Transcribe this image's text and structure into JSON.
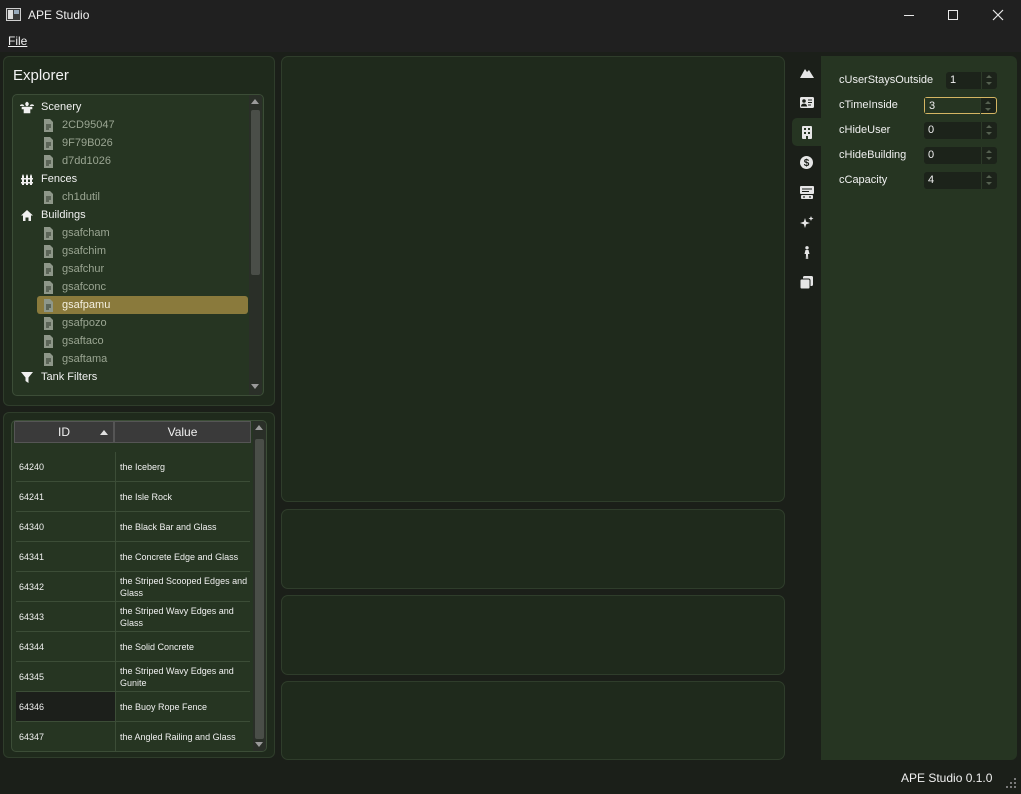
{
  "window": {
    "title": "APE Studio",
    "menu": {
      "file": "File"
    }
  },
  "explorer": {
    "title": "Explorer",
    "tree": [
      {
        "type": "category",
        "label": "Scenery",
        "icon": "fountain-icon"
      },
      {
        "type": "item",
        "label": "2CD95047"
      },
      {
        "type": "item",
        "label": "9F79B026"
      },
      {
        "type": "item",
        "label": "d7dd1026"
      },
      {
        "type": "category",
        "label": "Fences",
        "icon": "fence-icon"
      },
      {
        "type": "item",
        "label": "ch1dutil"
      },
      {
        "type": "category",
        "label": "Buildings",
        "icon": "home-icon"
      },
      {
        "type": "item",
        "label": "gsafcham"
      },
      {
        "type": "item",
        "label": "gsafchim"
      },
      {
        "type": "item",
        "label": "gsafchur"
      },
      {
        "type": "item",
        "label": "gsafconc"
      },
      {
        "type": "item",
        "label": "gsafpamu",
        "selected": true
      },
      {
        "type": "item",
        "label": "gsafpozo"
      },
      {
        "type": "item",
        "label": "gsaftaco"
      },
      {
        "type": "item",
        "label": "gsaftama"
      },
      {
        "type": "category",
        "label": "Tank Filters",
        "icon": "filter-icon"
      }
    ]
  },
  "table": {
    "columns": [
      "ID",
      "Value"
    ],
    "sort_column": "ID",
    "rows": [
      {
        "id": "64240",
        "value": "the Iceberg"
      },
      {
        "id": "64241",
        "value": "the Isle Rock"
      },
      {
        "id": "64340",
        "value": "the Black Bar and Glass"
      },
      {
        "id": "64341",
        "value": "the Concrete Edge and Glass"
      },
      {
        "id": "64342",
        "value": "the Striped Scooped Edges and Glass"
      },
      {
        "id": "64343",
        "value": "the Striped Wavy Edges and Glass"
      },
      {
        "id": "64344",
        "value": "the Solid Concrete"
      },
      {
        "id": "64345",
        "value": "the Striped Wavy Edges and Gunite"
      },
      {
        "id": "64346",
        "value": "the Buoy Rope Fence",
        "selected": true
      },
      {
        "id": "64347",
        "value": "the Angled Railing and Glass"
      }
    ]
  },
  "side_tabs": [
    {
      "icon": "mountain-icon"
    },
    {
      "icon": "id-card-icon"
    },
    {
      "icon": "building-icon",
      "active": true
    },
    {
      "icon": "dollar-icon"
    },
    {
      "icon": "sign-icon"
    },
    {
      "icon": "sparkles-icon"
    },
    {
      "icon": "person-icon"
    },
    {
      "icon": "layers-icon"
    }
  ],
  "properties": [
    {
      "label": "cUserStaysOutside",
      "value": "1"
    },
    {
      "label": "cTimeInside",
      "value": "3",
      "focused": true
    },
    {
      "label": "cHideUser",
      "value": "0"
    },
    {
      "label": "cHideBuilding",
      "value": "0"
    },
    {
      "label": "cCapacity",
      "value": "4"
    }
  ],
  "status": {
    "text": "APE Studio 0.1.0"
  },
  "colors": {
    "background": "#1b1f19",
    "panel": "#1f2a1c",
    "panel_inner": "#263522",
    "selection": "#8a7a3c",
    "focus_border": "#d4b563"
  }
}
